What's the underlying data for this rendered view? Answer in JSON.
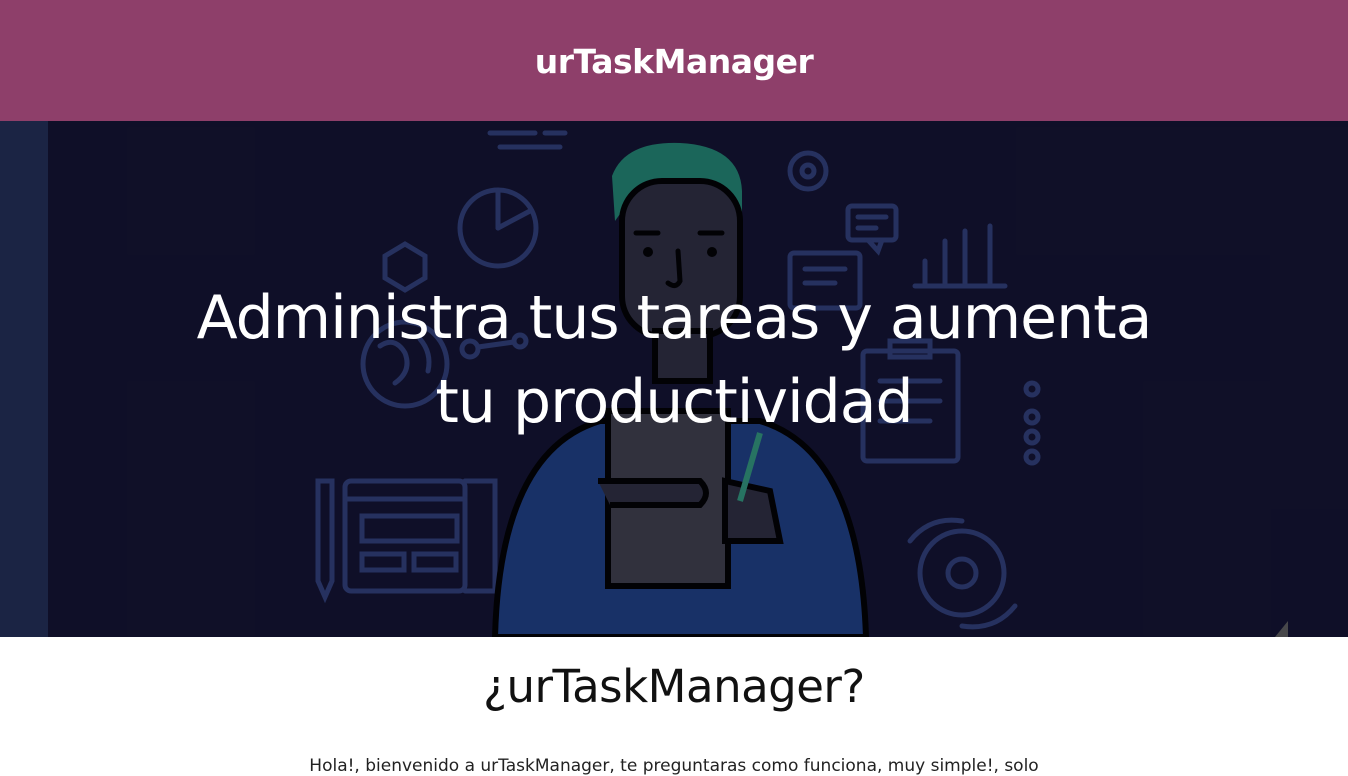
{
  "header": {
    "brand": "urTaskManager",
    "background_color": "#8e3f6a"
  },
  "hero": {
    "title_line1": "Administra tus tareas y aumenta",
    "title_line2": "tu productividad",
    "background_color": "#11112b",
    "illustration": "person-writing-on-clipboard-illustration"
  },
  "section": {
    "title": "¿urTaskManager?",
    "intro": "Hola!, bienvenido a urTaskManager, te preguntaras como funciona, muy simple!, solo"
  }
}
